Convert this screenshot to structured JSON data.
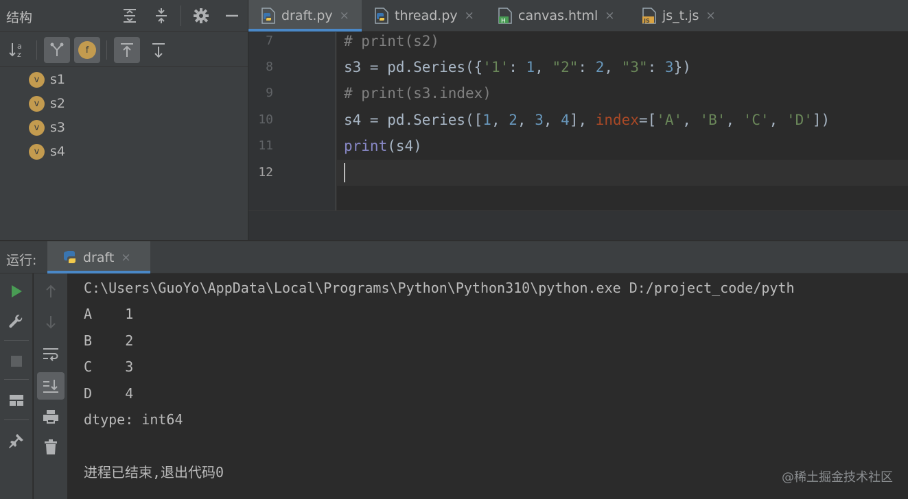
{
  "structure": {
    "title": "结构",
    "items": [
      {
        "badge": "v",
        "label": "s1"
      },
      {
        "badge": "v",
        "label": "s2"
      },
      {
        "badge": "v",
        "label": "s3"
      },
      {
        "badge": "v",
        "label": "s4"
      }
    ],
    "field_badge": "f"
  },
  "editor_tabs": [
    {
      "label": "draft.py",
      "close": "×",
      "active": true
    },
    {
      "label": "thread.py",
      "close": "×",
      "active": false
    },
    {
      "label": "canvas.html",
      "close": "×",
      "active": false
    },
    {
      "label": "js_t.js",
      "close": "×",
      "active": false
    }
  ],
  "file_icon_letters": {
    "html": "H",
    "js": "JS"
  },
  "editor": {
    "line_numbers": [
      "7",
      "8",
      "9",
      "10",
      "11",
      "12"
    ],
    "current_line": "12",
    "lines": [
      [
        {
          "t": "# print(s2)",
          "c": "comment"
        }
      ],
      [
        {
          "t": "s3 = pd.Series({",
          "c": ""
        },
        {
          "t": "'1'",
          "c": "str"
        },
        {
          "t": ": ",
          "c": ""
        },
        {
          "t": "1",
          "c": "num"
        },
        {
          "t": ", ",
          "c": ""
        },
        {
          "t": "\"2\"",
          "c": "str"
        },
        {
          "t": ": ",
          "c": ""
        },
        {
          "t": "2",
          "c": "num"
        },
        {
          "t": ", ",
          "c": ""
        },
        {
          "t": "\"3\"",
          "c": "str"
        },
        {
          "t": ": ",
          "c": ""
        },
        {
          "t": "3",
          "c": "num"
        },
        {
          "t": "})",
          "c": ""
        }
      ],
      [
        {
          "t": "# print(s3.index)",
          "c": "comment"
        }
      ],
      [
        {
          "t": "s4 = pd.Series([",
          "c": ""
        },
        {
          "t": "1",
          "c": "num"
        },
        {
          "t": ", ",
          "c": ""
        },
        {
          "t": "2",
          "c": "num"
        },
        {
          "t": ", ",
          "c": ""
        },
        {
          "t": "3",
          "c": "num"
        },
        {
          "t": ", ",
          "c": ""
        },
        {
          "t": "4",
          "c": "num"
        },
        {
          "t": "], ",
          "c": ""
        },
        {
          "t": "index",
          "c": "kw"
        },
        {
          "t": "=[",
          "c": ""
        },
        {
          "t": "'A'",
          "c": "str"
        },
        {
          "t": ", ",
          "c": ""
        },
        {
          "t": "'B'",
          "c": "str"
        },
        {
          "t": ", ",
          "c": ""
        },
        {
          "t": "'C'",
          "c": "str"
        },
        {
          "t": ", ",
          "c": ""
        },
        {
          "t": "'D'",
          "c": "str"
        },
        {
          "t": "])",
          "c": ""
        }
      ],
      [
        {
          "t": "print",
          "c": "builtin"
        },
        {
          "t": "(s4)",
          "c": ""
        }
      ],
      []
    ]
  },
  "run": {
    "title": "运行:",
    "tab_label": "draft",
    "tab_close": "×",
    "output": [
      "C:\\Users\\GuoYo\\AppData\\Local\\Programs\\Python\\Python310\\python.exe D:/project_code/pyth",
      "A    1",
      "B    2",
      "C    3",
      "D    4",
      "dtype: int64",
      "",
      "进程已结束,退出代码0"
    ]
  },
  "watermark": "@稀土掘金技术社区",
  "colors": {
    "accent": "#4a88c7",
    "run_green": "#499c54",
    "badge_gold": "#c39b4f"
  }
}
